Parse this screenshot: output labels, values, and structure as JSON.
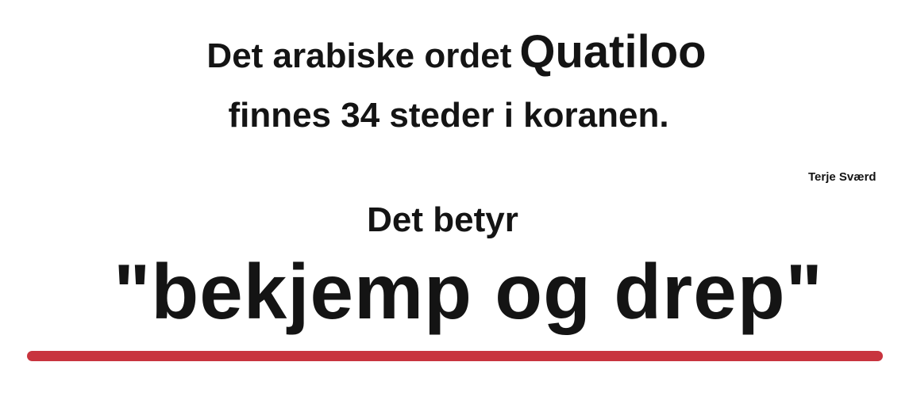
{
  "headline": {
    "line1_prefix": "Det arabiske ordet",
    "line1_word": "Quatiloo",
    "line2": "finnes 34 steder i koranen."
  },
  "author": "Terje Sværd",
  "meaning": {
    "intro": "Det betyr",
    "quote": "\"bekjemp og drep\""
  },
  "colors": {
    "text": "#141414",
    "rule": "#c8343e",
    "background": "#ffffff"
  }
}
